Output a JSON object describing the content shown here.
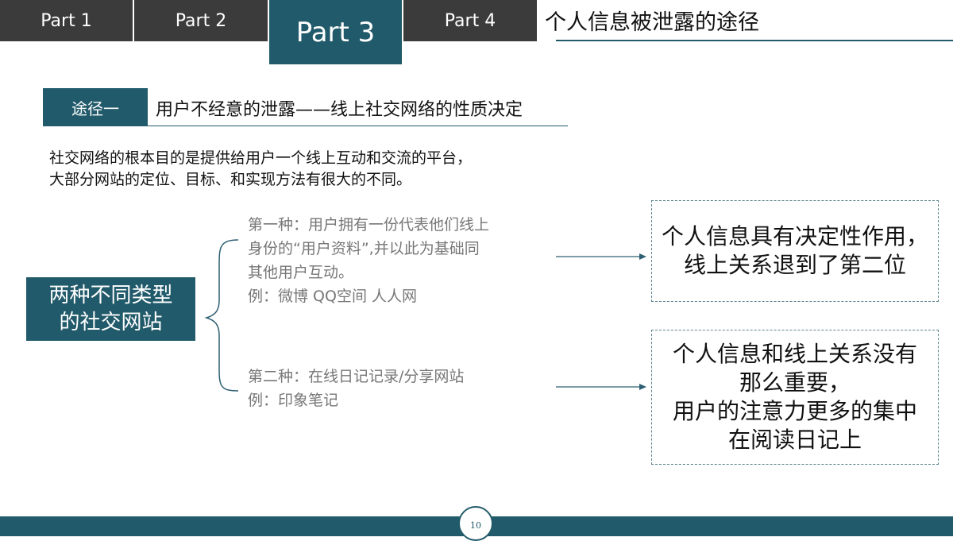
{
  "tabs": [
    {
      "label": "Part 1"
    },
    {
      "label": "Part 2"
    },
    {
      "label": "Part 3",
      "active": true
    },
    {
      "label": "Part 4"
    }
  ],
  "header": {
    "title": "个人信息被泄露的途径"
  },
  "route": {
    "badge": "途径一",
    "title": "用户不经意的泄露——线上社交网络的性质决定"
  },
  "intro": [
    "社交网络的根本目的是提供给用户一个线上互动和交流的平台，",
    "大部分网站的定位、目标、和实现方法有很大的不同。"
  ],
  "left_box": [
    "两种不同类型",
    "的社交网站"
  ],
  "type_one": [
    "第一种：用户拥有一份代表他们线上",
    "身份的“用户资料”,并以此为基础同",
    "其他用户互动。",
    "例：微博 QQ空间 人人网"
  ],
  "type_two": [
    "第二种：在线日记记录/分享网站",
    "例：印象笔记"
  ],
  "result_one": [
    "个人信息具有决定性作用，",
    "线上关系退到了第二位"
  ],
  "result_two": [
    "个人信息和线上关系没有",
    "那么重要，",
    "用户的注意力更多的集中",
    "在阅读日记上"
  ],
  "page_number": "10",
  "colors": {
    "accent": "#215a6a",
    "tab_dark": "#3b3b3b"
  }
}
